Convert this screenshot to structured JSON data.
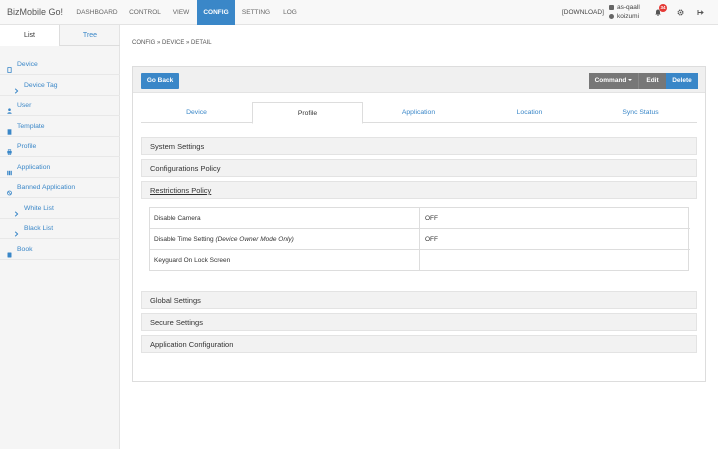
{
  "app": {
    "brand": "BizMobile Go!"
  },
  "nav": {
    "items": [
      "DASHBOARD",
      "CONTROL",
      "VIEW",
      "CONFIG",
      "SETTING",
      "LOG"
    ],
    "download": "[DOWNLOAD]",
    "user_org": "as-qaall",
    "user_name": "koizumi",
    "notification_count": "34",
    "accent": "#3a87c8"
  },
  "sidebar": {
    "tabs": [
      "List",
      "Tree"
    ],
    "items": [
      {
        "label": "Device",
        "icon": "mobile-icon"
      },
      {
        "label": "Device Tag",
        "icon": "chevron-right-icon"
      },
      {
        "label": "User",
        "icon": "user-icon"
      },
      {
        "label": "Template",
        "icon": "file-icon"
      },
      {
        "label": "Profile",
        "icon": "print-icon"
      },
      {
        "label": "Application",
        "icon": "grid-icon"
      },
      {
        "label": "Banned Application",
        "icon": "ban-icon"
      },
      {
        "label": "White List",
        "icon": "chevron-right-icon"
      },
      {
        "label": "Black List",
        "icon": "chevron-right-icon"
      },
      {
        "label": "Book",
        "icon": "book-icon"
      }
    ]
  },
  "breadcrumb": "CONFIG » DEVICE » DETAIL",
  "toolbar": {
    "go_back": "Go Back",
    "command": "Command",
    "edit": "Edit",
    "delete": "Delete"
  },
  "tabs": [
    "Device",
    "Profile",
    "Application",
    "Location",
    "Sync Status"
  ],
  "sections": {
    "system": "System Settings",
    "configurations": "Configurations Policy",
    "restrictions": "Restrictions Policy",
    "global": "Global Settings",
    "secure": "Secure Settings",
    "appconfig": "Application Configuration"
  },
  "restrictions": [
    {
      "key": "Disable Camera",
      "note": "",
      "value": "OFF"
    },
    {
      "key": "Disable Time Setting",
      "note": "(Device Owner Mode Only)",
      "value": "OFF"
    },
    {
      "key": "Keyguard On Lock Screen",
      "note": "",
      "value": ""
    }
  ]
}
